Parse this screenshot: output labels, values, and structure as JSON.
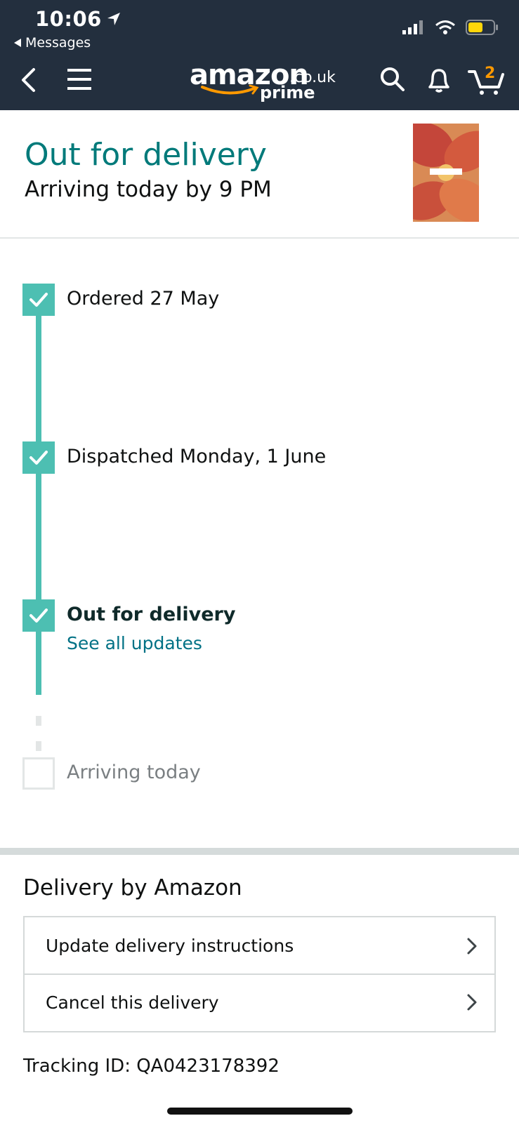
{
  "status_bar": {
    "time": "10:06",
    "back_app_label": "Messages"
  },
  "header": {
    "logo_text": "amazon",
    "logo_tld": ".co.uk",
    "logo_prime": "prime",
    "cart_count": "2"
  },
  "delivery": {
    "status": "Out for delivery",
    "arrival": "Arriving today by 9 PM"
  },
  "timeline": [
    {
      "label": "Ordered 27 May",
      "done": true
    },
    {
      "label": "Dispatched Monday, 1 June",
      "done": true
    },
    {
      "label": "Out for delivery",
      "done": true,
      "current": true,
      "link": "See all updates"
    },
    {
      "label": "Arriving today",
      "done": false
    }
  ],
  "delivery_section": {
    "title": "Delivery by Amazon",
    "options": [
      {
        "label": "Update delivery instructions"
      },
      {
        "label": "Cancel this delivery"
      }
    ],
    "tracking": "Tracking ID: QA0423178392"
  },
  "colors": {
    "header_bg": "#232f3e",
    "accent_teal": "#007a7a",
    "timeline": "#4dbfb2",
    "link": "#007185",
    "prime_orange": "#ff9900"
  }
}
